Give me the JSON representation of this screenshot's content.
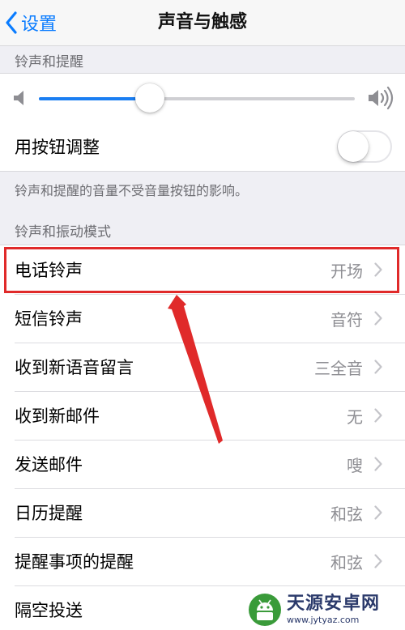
{
  "nav": {
    "back_label": "设置",
    "title": "声音与触感"
  },
  "sections": {
    "ringer_header": "铃声和提醒",
    "ringer_footnote": "铃声和提醒的音量不受音量按钮的影响。",
    "patterns_header": "铃声和振动模式"
  },
  "volume": {
    "level": 0.35
  },
  "change_with_buttons": {
    "label": "用按钮调整",
    "enabled": false
  },
  "sound_rows": [
    {
      "label": "电话铃声",
      "value": "开场"
    },
    {
      "label": "短信铃声",
      "value": "音符"
    },
    {
      "label": "收到新语音留言",
      "value": "三全音"
    },
    {
      "label": "收到新邮件",
      "value": "无"
    },
    {
      "label": "发送邮件",
      "value": "嗖"
    },
    {
      "label": "日历提醒",
      "value": "和弦"
    },
    {
      "label": "提醒事项的提醒",
      "value": "和弦"
    },
    {
      "label": "隔空投送",
      "value": ""
    }
  ],
  "colors": {
    "accent": "#0a7cff",
    "highlight": "#e02a2a"
  },
  "watermark": {
    "title": "天源安卓网",
    "url": "www.jytyaz.com"
  }
}
